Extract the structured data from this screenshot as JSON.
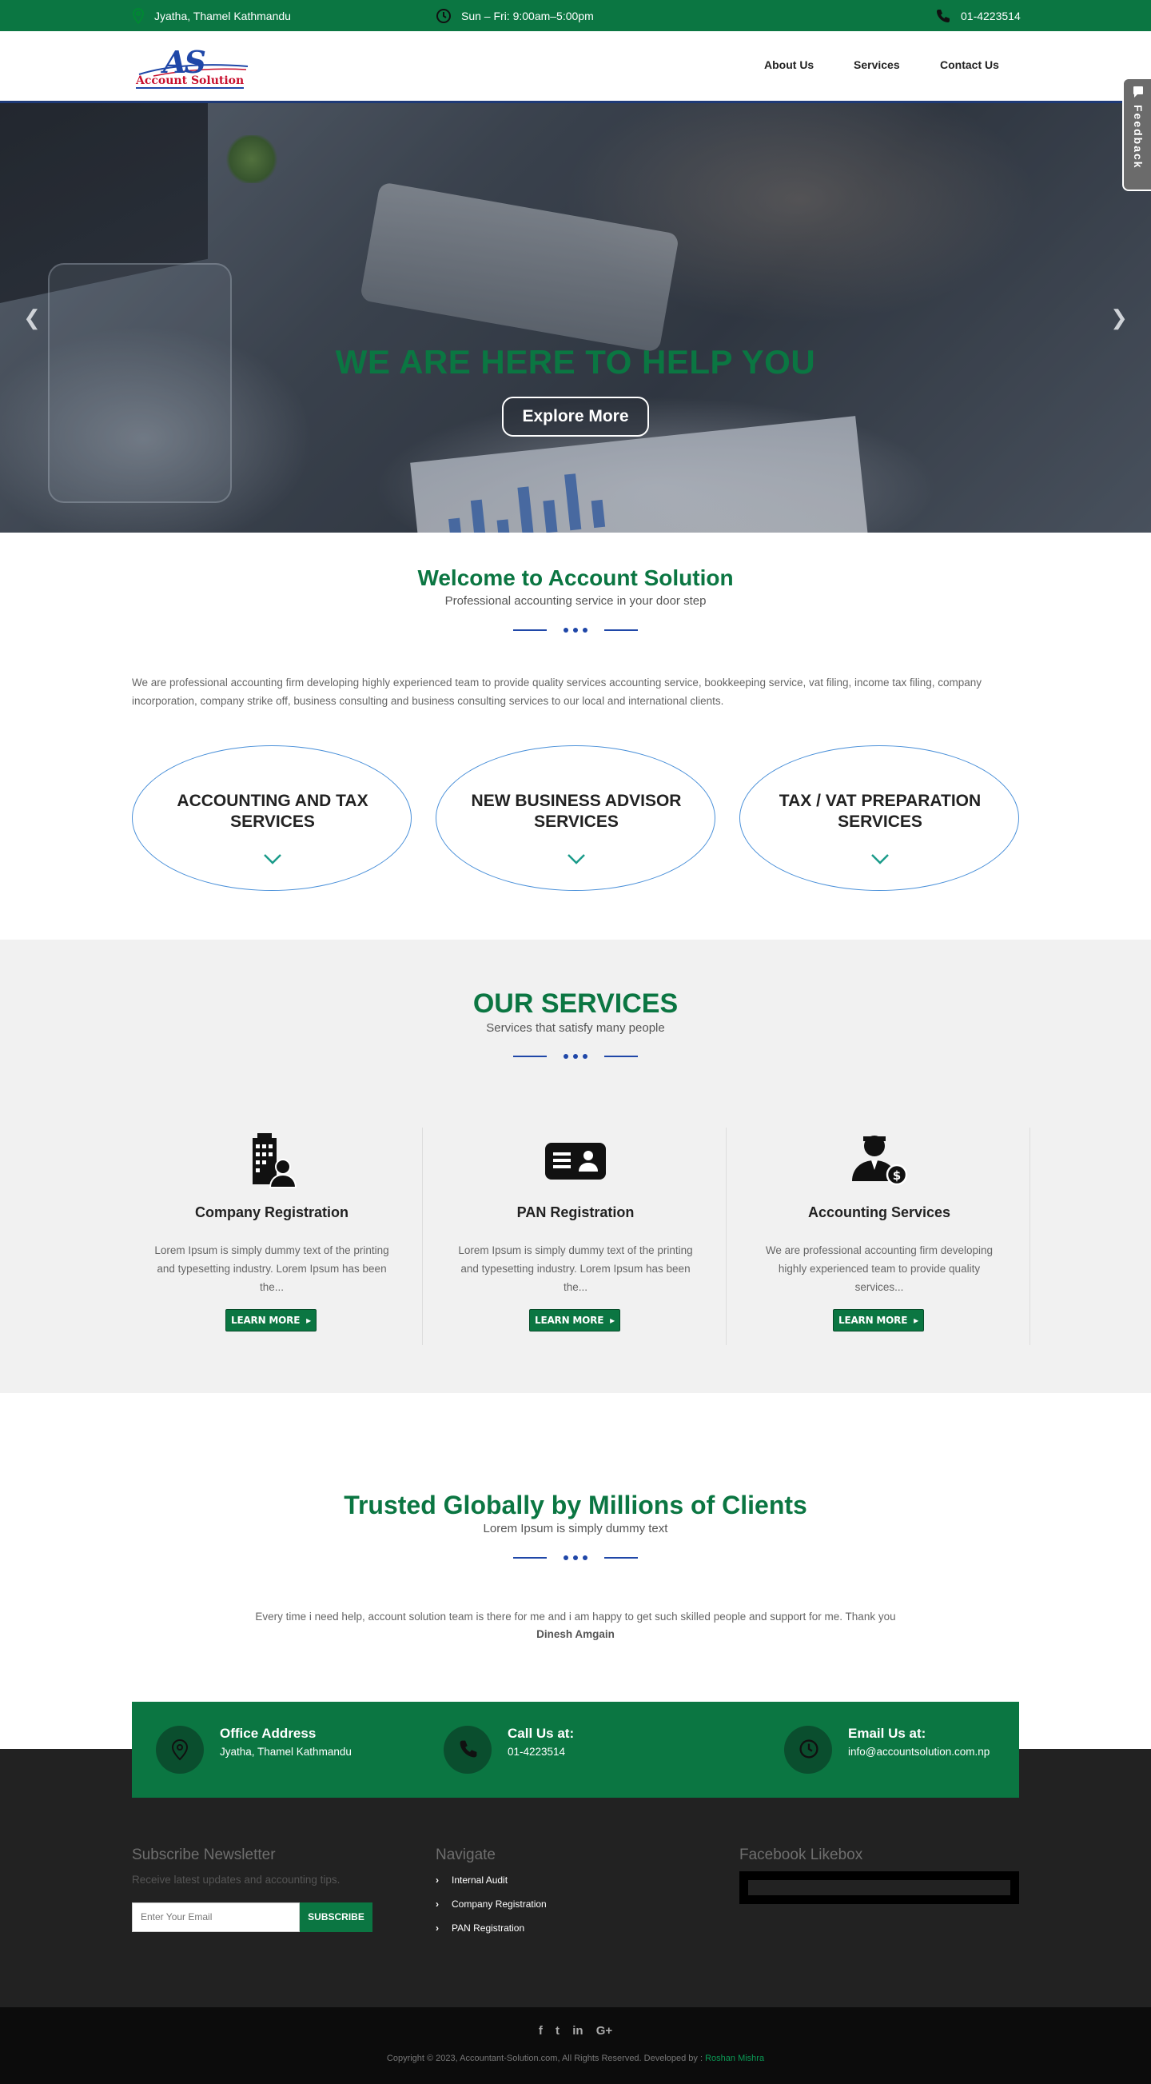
{
  "topbar": {
    "address": "Jyatha, Thamel Kathmandu",
    "hours": "Sun – Fri: 9:00am–5:00pm",
    "phone": "01-4223514"
  },
  "logo": {
    "mark": "AS",
    "text": "Account Solution"
  },
  "nav": {
    "about": "About Us",
    "services": "Services",
    "contact": "Contact Us"
  },
  "feedback": {
    "label": "Feedback"
  },
  "hero": {
    "headline": "WE ARE HERE TO HELP YOU",
    "button": "Explore More"
  },
  "welcome": {
    "title": "Welcome to Account Solution",
    "subtitle": "Professional accounting service in your door step",
    "body": "We are professional accounting firm developing highly experienced team to provide quality services  accounting service, bookkeeping service, vat filing, income tax filing, company incorporation, company strike off, business consulting and business consulting services to our  local and international clients.",
    "ovals": [
      {
        "line1": "ACCOUNTING AND TAX",
        "line2": "SERVICES"
      },
      {
        "line1": "NEW BUSINESS ADVISOR",
        "line2": "SERVICES"
      },
      {
        "line1": "TAX / VAT PREPARATION",
        "line2": "SERVICES"
      }
    ]
  },
  "services": {
    "title": "OUR SERVICES",
    "subtitle": "Services that satisfy many people",
    "items": [
      {
        "icon": "building-person-icon",
        "name": "Company Registration",
        "desc": "Lorem Ipsum is simply dummy text of the printing and typesetting industry. Lorem Ipsum has been the...",
        "button": "LEARN MORE"
      },
      {
        "icon": "id-card-icon",
        "name": "PAN Registration",
        "desc": "Lorem Ipsum is simply dummy text of the printing and typesetting industry. Lorem Ipsum has been the...",
        "button": "LEARN MORE"
      },
      {
        "icon": "accountant-dollar-icon",
        "name": "Accounting Services",
        "desc": "We are professional accounting firm developing highly experienced team to provide quality services...",
        "button": "LEARN MORE"
      }
    ]
  },
  "trusted": {
    "title": "Trusted Globally by Millions of Clients",
    "subtitle": "Lorem Ipsum is simply dummy text",
    "quote": "Every time i need help, account solution team is there for me and i am happy to get such skilled people and support for me. Thank you",
    "author": "Dinesh Amgain"
  },
  "contact": {
    "office_heading": "Office Address",
    "office_value": "Jyatha, Thamel Kathmandu",
    "call_heading": "Call Us at:",
    "call_value": "01-4223514",
    "email_heading": "Email Us at:",
    "email_value": "info@accountsolution.com.np"
  },
  "footer": {
    "newsletter_heading": "Subscribe Newsletter",
    "newsletter_sub": "Receive latest updates and accounting tips.",
    "email_placeholder": "Enter Your Email",
    "subscribe": "SUBSCRIBE",
    "navigate_heading": "Navigate",
    "nav_links": [
      "Internal Audit",
      "Company Registration",
      "PAN Registration"
    ],
    "facebook_heading": "Facebook Likebox",
    "social": [
      "f",
      "t",
      "in",
      "G+"
    ],
    "copyright": "Copyright © 2023, Accountant-Solution.com, All Rights Reserved. Developed by : ",
    "developer": "Roshan Mishra"
  },
  "colors": {
    "brand_green": "#0b7642",
    "divider_blue": "#1f47a8",
    "footer_dark": "#222222"
  }
}
